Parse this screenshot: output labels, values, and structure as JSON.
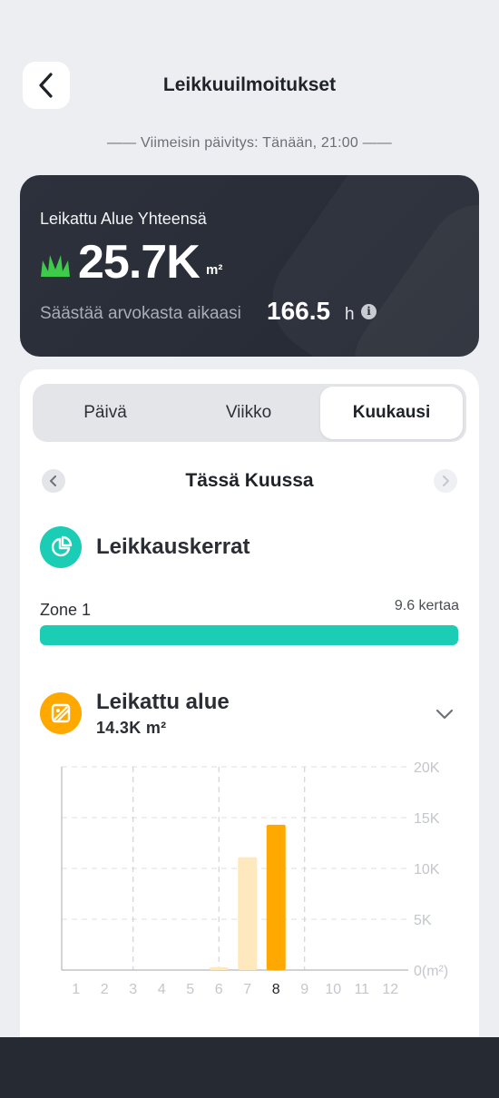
{
  "header": {
    "title": "Leikkuuilmoitukset",
    "back_icon": "chevron-left-icon"
  },
  "update_line": "—— Viimeisin päivitys: Tänään, 21:00 ——",
  "summary": {
    "label": "Leikattu Alue Yhteensä",
    "total_value": "25.7K",
    "total_unit": "m²",
    "saved_label": "Säästää arvokasta aikaasi",
    "saved_value": "166.5",
    "saved_unit": "h",
    "info_glyph": "i",
    "grass_color": "#3dcb4a"
  },
  "tabs": [
    {
      "label": "Päivä",
      "active": false
    },
    {
      "label": "Viikko",
      "active": false
    },
    {
      "label": "Kuukausi",
      "active": true
    }
  ],
  "period": {
    "title": "Tässä Kuussa"
  },
  "mowing_count": {
    "title": "Leikkauskerrat",
    "icon": "pie-chart-icon",
    "color": "#1ccdb5",
    "zones": [
      {
        "label": "Zone 1",
        "value": "9.6 kertaa",
        "fill_fraction": 1.0
      }
    ]
  },
  "area": {
    "title": "Leikattu alue",
    "value": "14.3K m²",
    "icon": "image-area-icon",
    "color": "#ffa800"
  },
  "chart_data": {
    "type": "bar",
    "categories": [
      "1",
      "2",
      "3",
      "4",
      "5",
      "6",
      "7",
      "8",
      "9",
      "10",
      "11",
      "12"
    ],
    "values": [
      0,
      0,
      0,
      0,
      0,
      200,
      11100,
      14300,
      0,
      0,
      0,
      0
    ],
    "highlight_index": 7,
    "ylim": [
      0,
      20000
    ],
    "y_ticks": [
      "0(m²)",
      "5K",
      "10K",
      "15K",
      "20K"
    ],
    "grid": true,
    "colors": {
      "bar": "#fde9bd",
      "highlight": "#ffa800"
    }
  }
}
